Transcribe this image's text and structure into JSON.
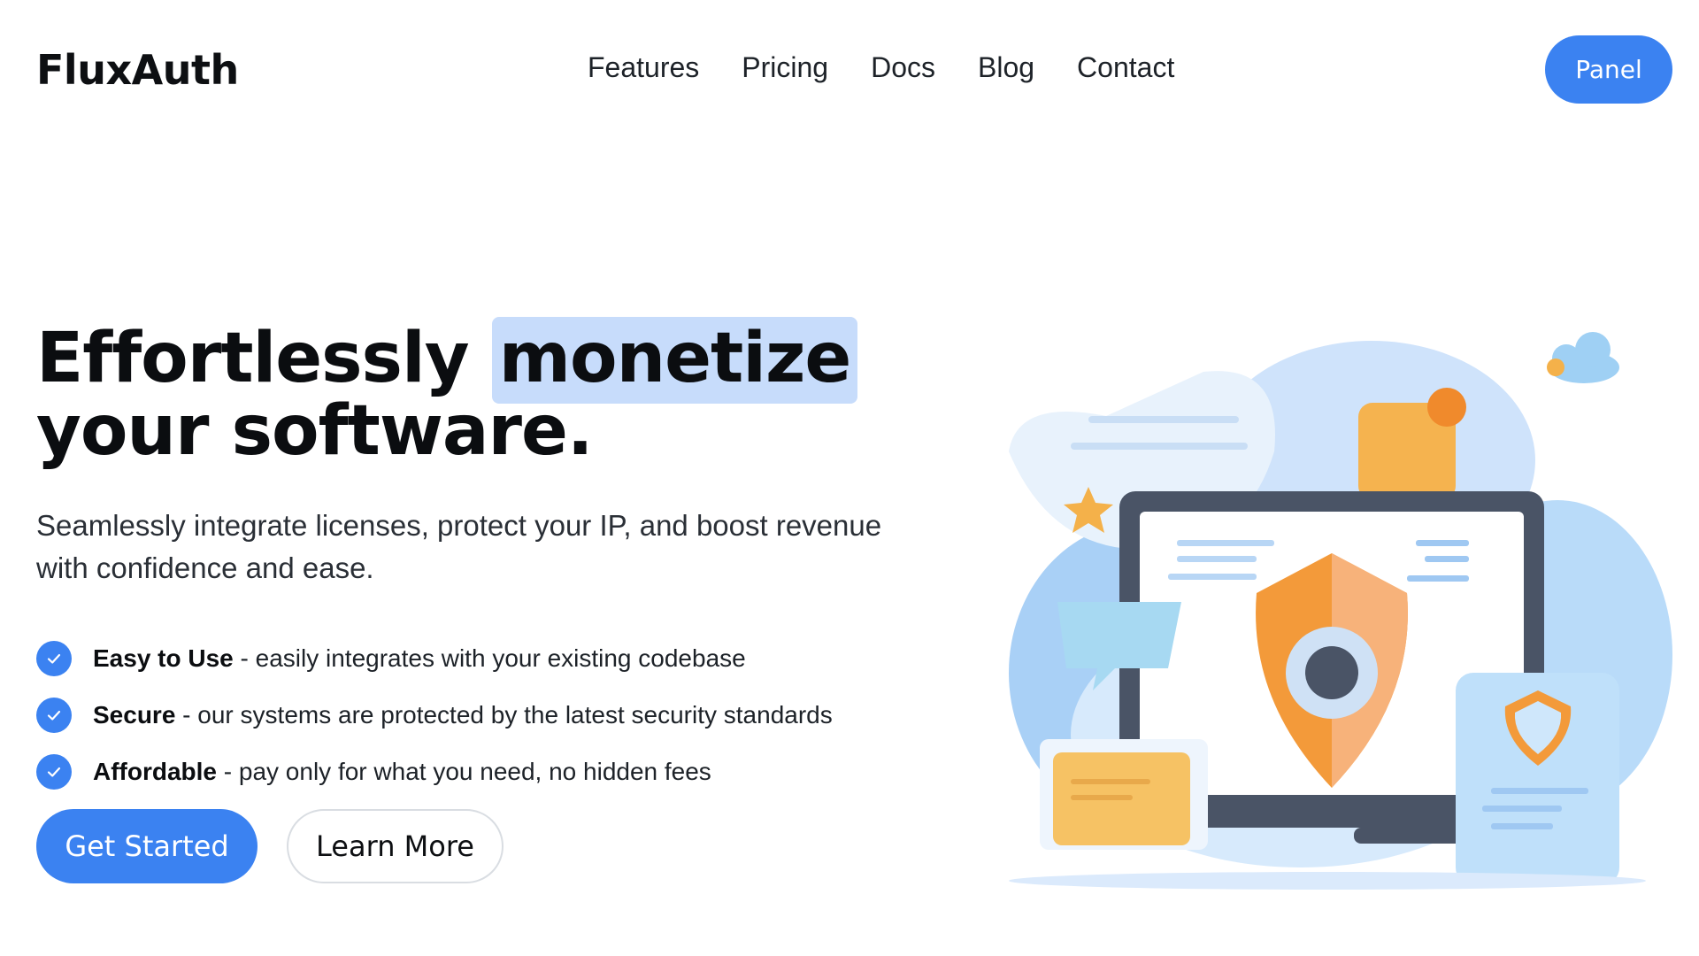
{
  "header": {
    "brand": "FluxAuth",
    "nav": [
      "Features",
      "Pricing",
      "Docs",
      "Blog",
      "Contact"
    ],
    "panel_label": "Panel"
  },
  "hero": {
    "headline_part1": "Effortlessly ",
    "headline_highlight": "monetize",
    "headline_part2": "your software.",
    "subtitle": "Seamlessly integrate licenses, protect your IP, and boost revenue with confidence and ease.",
    "features": [
      {
        "title": "Easy to Use",
        "desc": " - easily integrates with your existing codebase",
        "icon": "check-circle-icon"
      },
      {
        "title": "Secure",
        "desc": " - our systems are protected by the latest security standards",
        "icon": "check-circle-icon"
      },
      {
        "title": "Affordable",
        "desc": " - pay only for what you need, no hidden fees",
        "icon": "check-circle-icon"
      }
    ],
    "primary_cta": "Get Started",
    "secondary_cta": "Learn More"
  },
  "theme": {
    "accent": "#3b82f1",
    "highlight": "#c7dcfb",
    "text": "#0b0d10"
  },
  "illustration": {
    "icon": "security-shield-monitor-illustration"
  }
}
